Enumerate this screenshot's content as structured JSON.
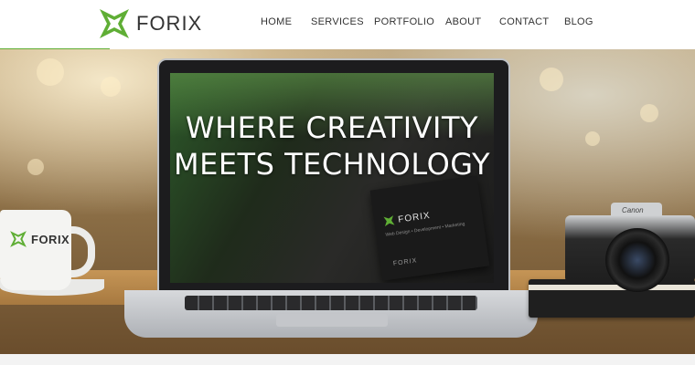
{
  "brand": {
    "name": "FORIX",
    "accent_color": "#5fae35"
  },
  "nav": {
    "items": [
      {
        "label": "HOME"
      },
      {
        "label": "SERVICES"
      },
      {
        "label": "PORTFOLIO"
      },
      {
        "label": "ABOUT"
      },
      {
        "label": "CONTACT"
      },
      {
        "label": "BLOG"
      }
    ]
  },
  "hero": {
    "title_line1": "WHERE CREATIVITY",
    "title_line2": "MEETS TECHNOLOGY"
  },
  "mug": {
    "logo_text": "FORIX"
  },
  "screen_card": {
    "logo_text": "FORIX",
    "tagline": "Web Design • Development • Marketing",
    "logo2_text": "FORIX"
  },
  "camera": {
    "brand_text": "Canon"
  }
}
